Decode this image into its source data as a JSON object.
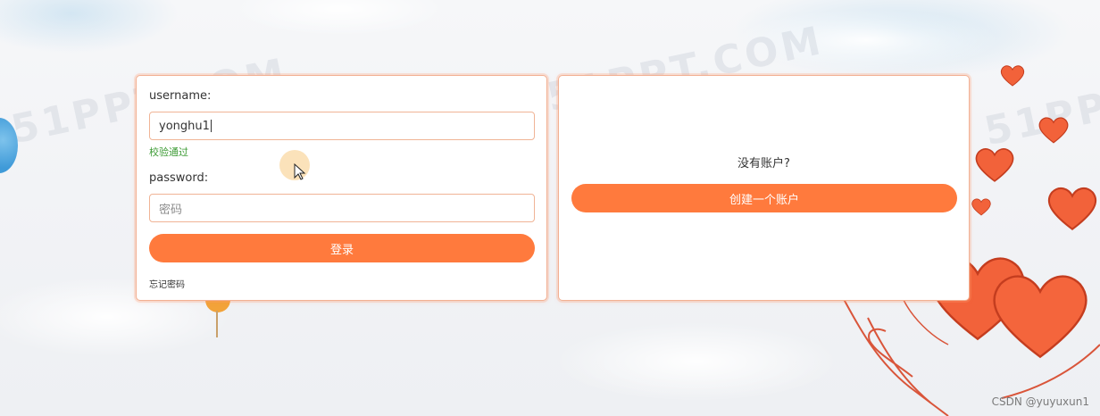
{
  "login": {
    "username_label": "username:",
    "username_value": "yonghu1",
    "validation_message": "校验通过",
    "password_label": "password:",
    "password_placeholder": "密码",
    "login_button": "登录",
    "forgot_link": "忘记密码"
  },
  "register": {
    "prompt": "没有账户?",
    "create_button": "创建一个账户"
  },
  "background": {
    "watermark_text": "51PPT.COM",
    "footer_watermark": "CSDN @yuyuxun1"
  },
  "colors": {
    "accent": "#ff7a3d",
    "success": "#3d9b35",
    "card_border": "#f2b092"
  }
}
